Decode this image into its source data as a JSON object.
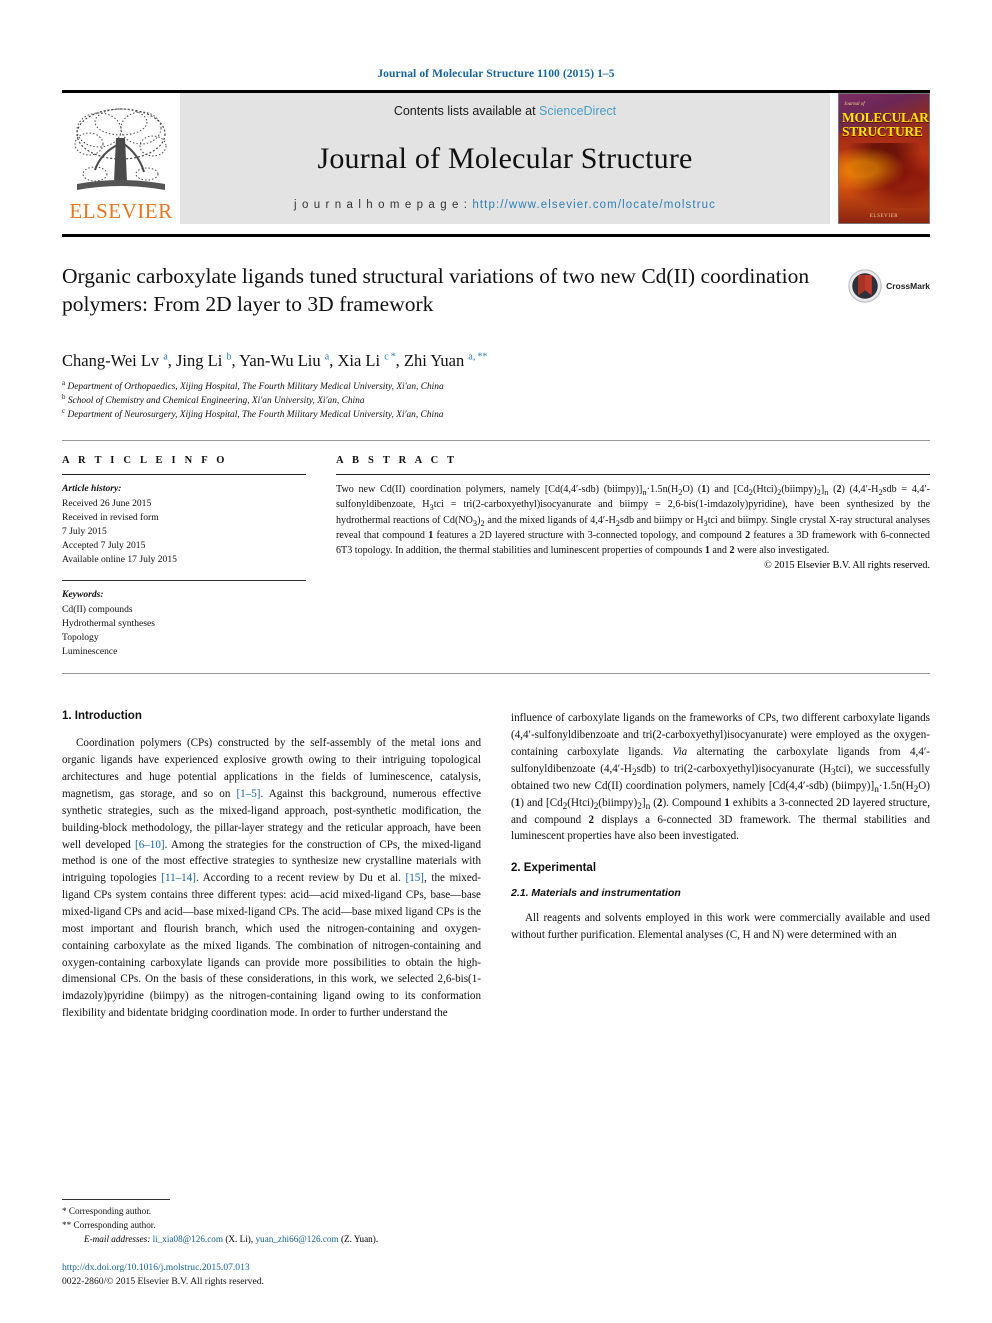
{
  "running_head": "Journal of Molecular Structure 1100 (2015) 1–5",
  "masthead": {
    "contents_prefix": "Contents lists available at ",
    "sciencedirect": "ScienceDirect",
    "journal_title": "Journal of Molecular Structure",
    "homepage_prefix": "j o u r n a l   h o m e p a g e :  ",
    "homepage_url": "http://www.elsevier.com/locate/molstruc",
    "publisher": "ELSEVIER",
    "cover": {
      "small_top": "Journal of",
      "line1": "MOLECULAR",
      "line2": "STRUCTURE",
      "bottom": "ELSEVIER"
    }
  },
  "article": {
    "title": "Organic carboxylate ligands tuned structural variations of two new Cd(II) coordination polymers: From 2D layer to 3D framework",
    "crossmark_label": "CrossMark",
    "authors_html": "Chang-Wei Lv <sup>a</sup>, Jing Li <sup>b</sup>, Yan-Wu Liu <sup>a</sup>, Xia Li <sup>c</sup><sup>&thinsp;*</sup>, Zhi Yuan <sup>a,&thinsp;**</sup>",
    "affiliations": [
      "Department of Orthopaedics, Xijing Hospital, The Fourth Military Medical University, Xi'an, China",
      "School of Chemistry and Chemical Engineering, Xi'an University, Xi'an, China",
      "Department of Neurosurgery, Xijing Hospital, The Fourth Military Medical University, Xi'an, China"
    ],
    "affiliation_marks": [
      "a",
      "b",
      "c"
    ]
  },
  "article_info": {
    "heading": "A R T I C L E   I N F O",
    "history_label": "Article history:",
    "history": [
      "Received 26 June 2015",
      "Received in revised form",
      "7 July 2015",
      "Accepted 7 July 2015",
      "Available online 17 July 2015"
    ],
    "keywords_label": "Keywords:",
    "keywords": [
      "Cd(II) compounds",
      "Hydrothermal syntheses",
      "Topology",
      "Luminescence"
    ]
  },
  "abstract": {
    "heading": "A B S T R A C T",
    "body_html": "Two new Cd(II) coordination polymers, namely [Cd(4,4&#8242;-sdb) (biimpy)]<sub>n</sub>&middot;1.5n(H<sub>2</sub>O) (<b>1</b>) and [Cd<sub>2</sub>(Htci)<sub>2</sub>(biimpy)<sub>2</sub>]<sub>n</sub> (<b>2</b>) (4,4&#8242;-H<sub>2</sub>sdb = 4,4&#8242;-sulfonyldibenzoate, H<sub>3</sub>tci = tri(2-carboxyethyl)isocyanurate and biimpy = 2,6-bis(1-imdazoly)pyridine), have been synthesized by the hydrothermal reactions of Cd(NO<sub>3</sub>)<sub>2</sub> and the mixed ligands of 4,4&#8242;-H<sub>2</sub>sdb and biimpy or H<sub>3</sub>tci and biimpy. Single crystal X-ray structural analyses reveal that compound <b>1</b> features a 2D layered structure with 3-connected topology, and compound <b>2</b> features a 3D framework with 6-connected 6T3 topology. In addition, the thermal stabilities and luminescent properties of compounds <b>1</b> and <b>2</b> were also investigated.",
    "copyright": "© 2015 Elsevier B.V. All rights reserved."
  },
  "sections": {
    "introduction": {
      "number_title": "1.  Introduction",
      "para1_html": "Coordination polymers (CPs) constructed by the self-assembly of the metal ions and organic ligands have experienced explosive growth owing to their intriguing topological architectures and huge potential applications in the fields of luminescence, catalysis, magnetism, gas storage, and so on <span class=\"ref\">[1&#8211;5]</span>. Against this background, numerous effective synthetic strategies, such as the mixed-ligand approach, post-synthetic modification, the building-block methodology, the pillar-layer strategy and the reticular approach, have been well developed <span class=\"ref\">[6&#8211;10]</span>. Among the strategies for the construction of CPs, the mixed-ligand method is one of the most effective strategies to synthesize new crystalline materials with intriguing topologies <span class=\"ref\">[11&#8211;14]</span>. According to a recent review by Du et al. <span class=\"ref\">[15]</span>, the mixed-ligand CPs system contains three different types: acid&#8212;acid mixed-ligand CPs, base&#8212;base mixed-ligand CPs and acid&#8212;base mixed-ligand CPs. The acid&#8212;base mixed ligand CPs is the most important and flourish branch, which used the nitrogen-containing and oxygen-containing carboxylate as the mixed ligands. The combination of nitrogen-containing and oxygen-containing carboxylate ligands can provide more possibilities to obtain the high-dimensional CPs. On the basis of these considerations, in this work, we selected 2,6-bis(1-imdazoly)pyridine (biimpy) as the nitrogen-containing ligand owing to its conformation flexibility and bidentate bridging coordination mode. In order to further understand the influence of carboxylate ligands on the frameworks of CPs, two different carboxylate ligands (4,4&#8242;-sulfonyldibenzoate and tri(2-carboxyethyl)isocyanurate) were employed as the oxygen-containing carboxylate ligands. <i>Via</i> alternating the carboxylate ligands from 4,4&#8242;-sulfonyldibenzoate (4,4&#8242;-H<sub>2</sub>sdb) to tri(2-carboxyethyl)isocyanurate (H<sub>3</sub>tci), we successfully obtained two new Cd(II) coordination polymers, namely [Cd(4,4&#8242;-sdb) (biimpy)]<sub>n</sub>&middot;1.5n(H<sub>2</sub>O) (<b>1</b>) and [Cd<sub>2</sub>(Htci)<sub>2</sub>(biimpy)<sub>2</sub>]<sub>n</sub> (<b>2</b>). Compound <b>1</b> exhibits a 3-connected 2D layered structure, and compound <b>2</b> displays a 6-connected 3D framework. The thermal stabilities and luminescent properties have also been investigated."
    },
    "experimental": {
      "number_title": "2.  Experimental",
      "sub_number_title": "2.1.  Materials and instrumentation",
      "para_html": "All reagents and solvents employed in this work were commercially available and used without further purification. Elemental analyses (C, H and N) were determined with an"
    }
  },
  "footnotes": {
    "corresponding_1_mark": "*",
    "corresponding_1": "Corresponding author.",
    "corresponding_2_mark": "**",
    "corresponding_2": "Corresponding author.",
    "email_label": "E-mail addresses:",
    "email_1": "li_xia08@126.com",
    "email_1_owner": "(X. Li),",
    "email_2": "yuan_zhi66@126.com",
    "email_2_owner": "(Z. Yuan).",
    "doi": "http://dx.doi.org/10.1016/j.molstruc.2015.07.013",
    "issn_line": "0022-2860/© 2015 Elsevier B.V. All rights reserved."
  },
  "colors": {
    "link": "#1a6496",
    "sciencedirect": "#4a9ec9",
    "elsevier_orange": "#E87722",
    "masthead_bg": "#e3e3e3"
  }
}
